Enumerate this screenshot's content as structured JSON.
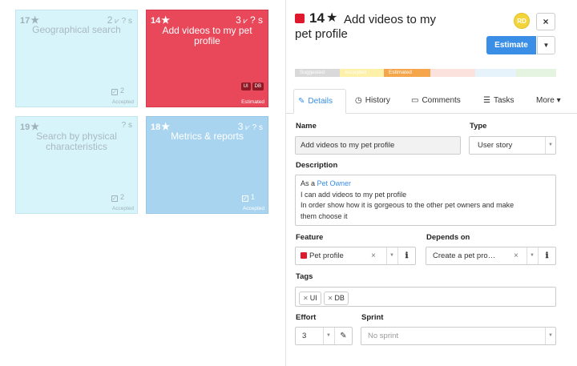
{
  "board": {
    "cards": [
      {
        "number": "17",
        "meta_count": "2",
        "meta_q": "? s",
        "title": "Geographical search",
        "check_count": "2",
        "status": "Accepted",
        "color": "#d8f4fb"
      },
      {
        "number": "14",
        "meta_count": "3",
        "meta_q": "? s",
        "title": "Add videos to my pet profile",
        "tags": [
          "UI",
          "DB"
        ],
        "status": "Estimated",
        "color": "#e9485a"
      },
      {
        "number": "19",
        "meta_q": "? s",
        "title": "Search by physical characteristics",
        "check_count": "2",
        "status": "Accepted",
        "color": "#d8f4fb"
      },
      {
        "number": "18",
        "meta_count": "3",
        "meta_q": "? s",
        "title": "Metrics & reports",
        "check_count": "1",
        "status": "Accepted",
        "color": "#a9d4f0"
      }
    ]
  },
  "detail": {
    "number": "14",
    "title_line1": "Add videos to my",
    "title_line2": "pet profile",
    "avatar_initials": "RD",
    "close_label": "×",
    "estimate_label": "Estimate",
    "pipeline": [
      {
        "label": "Suggested",
        "color": "#d9d9d9",
        "text_color": "#ffffff"
      },
      {
        "label": "Accepted",
        "color": "#fdf0a8",
        "text_color": "#ffffff"
      },
      {
        "label": "Estimated",
        "color": "#f5a64a",
        "text_color": "#ffffff"
      },
      {
        "label": "",
        "color": "#fbe2dc",
        "text_color": "#ffffff"
      },
      {
        "label": "",
        "color": "#e6f3fb",
        "text_color": "#ffffff"
      },
      {
        "label": "",
        "color": "#e5f4e1",
        "text_color": "#ffffff"
      }
    ],
    "tabs": [
      {
        "label": "Details",
        "icon": "edit-icon",
        "glyph": "✎"
      },
      {
        "label": "History",
        "icon": "clock-icon",
        "glyph": "◷"
      },
      {
        "label": "Comments",
        "icon": "comment-icon",
        "glyph": "💬"
      },
      {
        "label": "Tasks",
        "icon": "tasks-icon",
        "glyph": "☰"
      },
      {
        "label": "More",
        "icon": "caret-down-icon",
        "glyph": "▾"
      }
    ],
    "form": {
      "name_label": "Name",
      "name_value": "Add videos to my pet profile",
      "type_label": "Type",
      "type_value": "User story",
      "description_label": "Description",
      "description_prefix": "As a ",
      "description_link": "Pet Owner",
      "description_line2": "I can add videos to my pet profile",
      "description_line3": "In order show how it is gorgeous to the other pet owners and make",
      "description_line4": "them choose it",
      "feature_label": "Feature",
      "feature_value": "Pet profile",
      "depends_label": "Depends on",
      "depends_value": "Create a pet pro…",
      "tags_label": "Tags",
      "tags": [
        "UI",
        "DB"
      ],
      "effort_label": "Effort",
      "effort_value": "3",
      "sprint_label": "Sprint",
      "sprint_placeholder": "No sprint"
    }
  }
}
